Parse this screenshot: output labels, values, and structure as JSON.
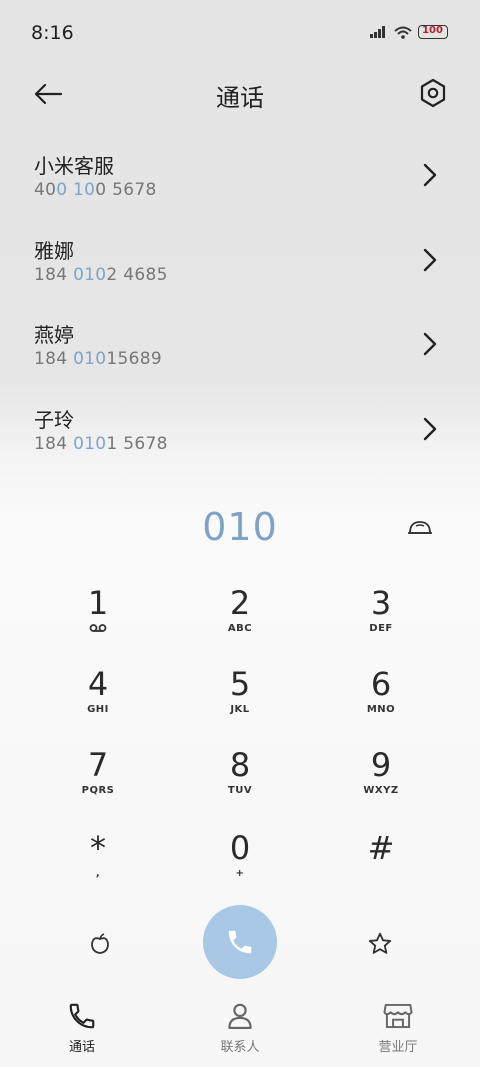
{
  "status_bar": {
    "time": "8:16",
    "icons": [
      "signal-icon",
      "wifi-icon",
      "battery-icon"
    ],
    "battery_level": "100"
  },
  "header": {
    "title": "通话",
    "back_icon": "arrow-left-icon",
    "settings_icon": "settings-icon"
  },
  "contacts": [
    {
      "name": "小米客服",
      "number_parts": [
        "40",
        "0 10",
        "0 5678"
      ]
    },
    {
      "name": "雅娜",
      "number_parts": [
        "184 ",
        "010",
        "2 4685"
      ]
    },
    {
      "name": "燕婷",
      "number_parts": [
        "184 ",
        "010",
        "15689"
      ]
    },
    {
      "name": "子玲",
      "number_parts": [
        "184 ",
        "010",
        "1 5678"
      ]
    }
  ],
  "dialer": {
    "display": "010",
    "keys": [
      {
        "digit": "1",
        "letters": "voicemail-icon"
      },
      {
        "digit": "2",
        "letters": "ABC"
      },
      {
        "digit": "3",
        "letters": "DEF"
      },
      {
        "digit": "4",
        "letters": "GHI"
      },
      {
        "digit": "5",
        "letters": "JKL"
      },
      {
        "digit": "6",
        "letters": "MNO"
      },
      {
        "digit": "7",
        "letters": "PQRS"
      },
      {
        "digit": "8",
        "letters": "TUV"
      },
      {
        "digit": "9",
        "letters": "WXYZ"
      },
      {
        "digit": "*",
        "letters": ","
      },
      {
        "digit": "0",
        "letters": "+"
      },
      {
        "digit": "#",
        "letters": ""
      }
    ]
  },
  "bottom_nav": {
    "items": [
      {
        "label": "通话",
        "icon": "phone-icon",
        "active": true
      },
      {
        "label": "联系人",
        "icon": "person-icon",
        "active": false
      },
      {
        "label": "营业厅",
        "icon": "store-icon",
        "active": false
      }
    ]
  },
  "colors": {
    "accent": "#7ea3c6",
    "call_button": "#a8c8e6"
  }
}
